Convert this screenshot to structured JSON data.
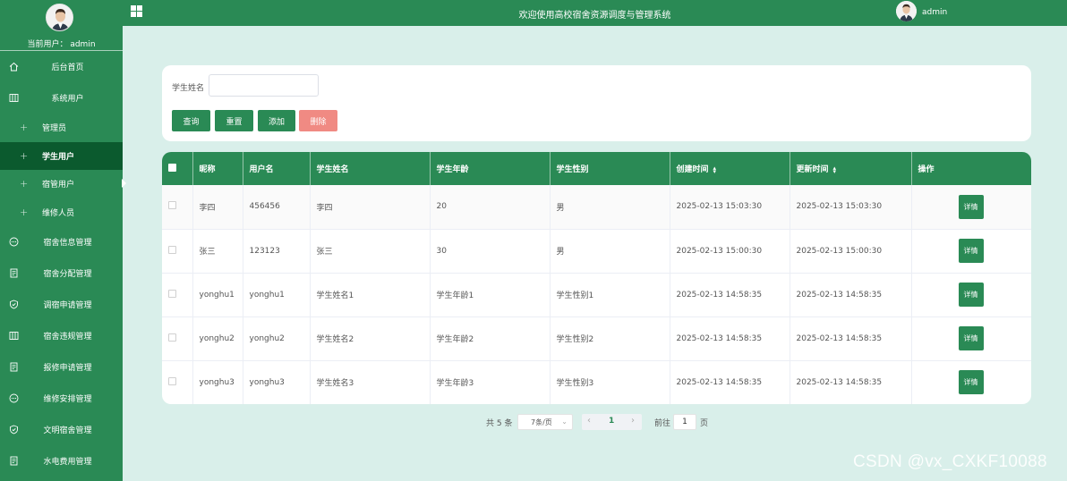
{
  "app": {
    "title": "欢迎使用高校宿舍资源调度与管理系统",
    "current_user_label": "当前用户： admin",
    "top_username": "admin"
  },
  "sidebar": {
    "items": [
      {
        "label": "后台首页",
        "icon": "home-icon"
      },
      {
        "label": "系统用户",
        "icon": "columns-icon"
      }
    ],
    "sub_items": [
      {
        "label": "管理员"
      },
      {
        "label": "学生用户"
      },
      {
        "label": "宿管用户"
      },
      {
        "label": "维修人员"
      }
    ],
    "items2": [
      {
        "label": "宿舍信息管理",
        "icon": "chat-icon"
      },
      {
        "label": "宿舍分配管理",
        "icon": "document-icon"
      },
      {
        "label": "调宿申请管理",
        "icon": "shield-icon"
      },
      {
        "label": "宿舍违规管理",
        "icon": "columns-icon"
      },
      {
        "label": "报修申请管理",
        "icon": "document-icon"
      },
      {
        "label": "维修安排管理",
        "icon": "chat-icon"
      },
      {
        "label": "文明宿舍管理",
        "icon": "shield-icon"
      },
      {
        "label": "水电费用管理",
        "icon": "document-icon"
      }
    ]
  },
  "search": {
    "label": "学生姓名",
    "value": "",
    "buttons": {
      "query": "查询",
      "reset": "重置",
      "add": "添加",
      "delete": "删除"
    }
  },
  "table": {
    "headers": [
      "昵称",
      "用户名",
      "学生姓名",
      "学生年龄",
      "学生性别",
      "创建时间",
      "更新时间",
      "操作"
    ],
    "detail_label": "详情",
    "rows": [
      [
        "李四",
        "456456",
        "李四",
        "20",
        "男",
        "2025-02-13 15:03:30",
        "2025-02-13 15:03:30"
      ],
      [
        "张三",
        "123123",
        "张三",
        "30",
        "男",
        "2025-02-13 15:00:30",
        "2025-02-13 15:00:30"
      ],
      [
        "yonghu1",
        "yonghu1",
        "学生姓名1",
        "学生年龄1",
        "学生性别1",
        "2025-02-13 14:58:35",
        "2025-02-13 14:58:35"
      ],
      [
        "yonghu2",
        "yonghu2",
        "学生姓名2",
        "学生年龄2",
        "学生性别2",
        "2025-02-13 14:58:35",
        "2025-02-13 14:58:35"
      ],
      [
        "yonghu3",
        "yonghu3",
        "学生姓名3",
        "学生年龄3",
        "学生性别3",
        "2025-02-13 14:58:35",
        "2025-02-13 14:58:35"
      ]
    ]
  },
  "pagination": {
    "total": "共 5 条",
    "page_size": "7条/页",
    "current_page": "1",
    "goto_label": "前往",
    "goto_value": "1",
    "page_suffix": "页"
  },
  "watermark": "CSDN @vx_CXKF10088",
  "colors": {
    "primary": "#2a8a55",
    "active": "#0b5a2e",
    "danger": "#f08a83",
    "background": "#d9efea"
  }
}
